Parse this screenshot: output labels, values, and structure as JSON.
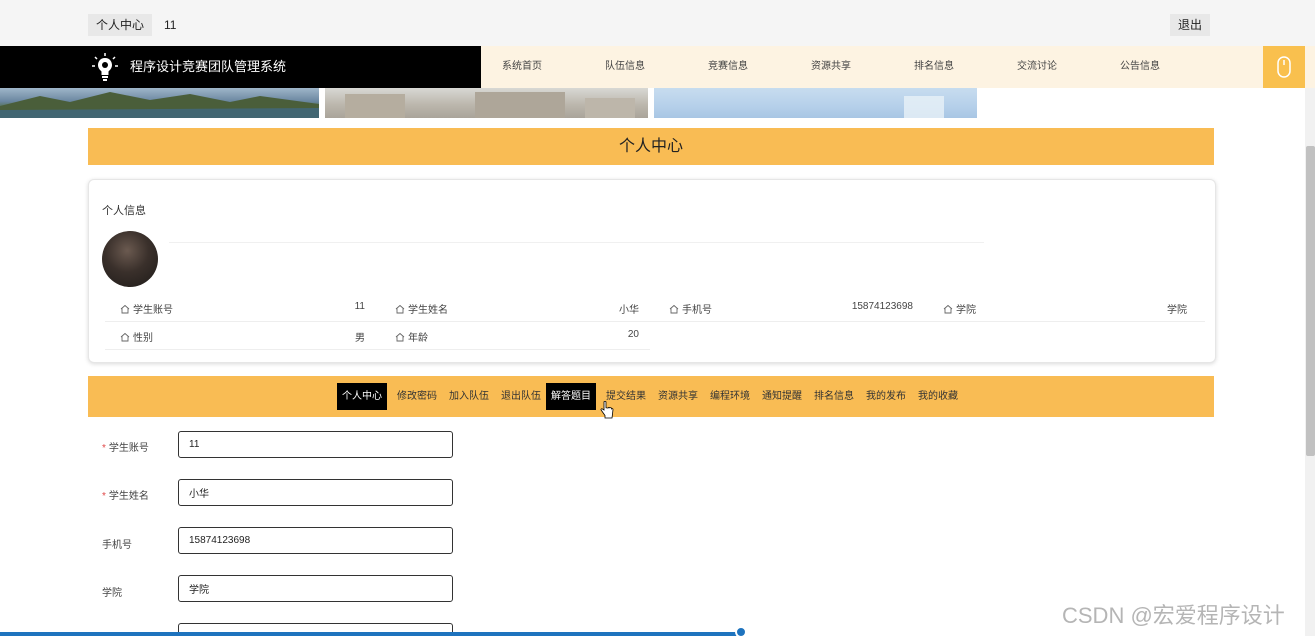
{
  "topbar": {
    "label": "个人中心",
    "username": "11",
    "logout": "退出"
  },
  "nav": {
    "site_title": "程序设计竞赛团队管理系统",
    "items": [
      "系统首页",
      "队伍信息",
      "竞赛信息",
      "资源共享",
      "排名信息",
      "交流讨论",
      "公告信息"
    ]
  },
  "page_title": "个人中心",
  "profile": {
    "card_title": "个人信息",
    "fields": [
      {
        "label": "学生账号",
        "value": "11"
      },
      {
        "label": "学生姓名",
        "value": "小华"
      },
      {
        "label": "手机号",
        "value": "15874123698"
      },
      {
        "label": "学院",
        "value": "学院"
      },
      {
        "label": "性别",
        "value": "男"
      },
      {
        "label": "年龄",
        "value": "20"
      }
    ]
  },
  "tabs": [
    "个人中心",
    "修改密码",
    "加入队伍",
    "退出队伍",
    "解答题目",
    "提交结果",
    "资源共享",
    "编程环境",
    "通知提醒",
    "排名信息",
    "我的发布",
    "我的收藏"
  ],
  "form": {
    "fields": [
      {
        "label": "学生账号",
        "value": "11",
        "required": true
      },
      {
        "label": "学生姓名",
        "value": "小华",
        "required": true
      },
      {
        "label": "手机号",
        "value": "15874123698",
        "required": false
      },
      {
        "label": "学院",
        "value": "学院",
        "required": false
      }
    ]
  },
  "watermark": "CSDN @宏爱程序设计",
  "colors": {
    "accent": "#f9bc54",
    "nav_bg": "#fdf3e2",
    "brand_bg": "#000000",
    "progress": "#1e73be"
  }
}
